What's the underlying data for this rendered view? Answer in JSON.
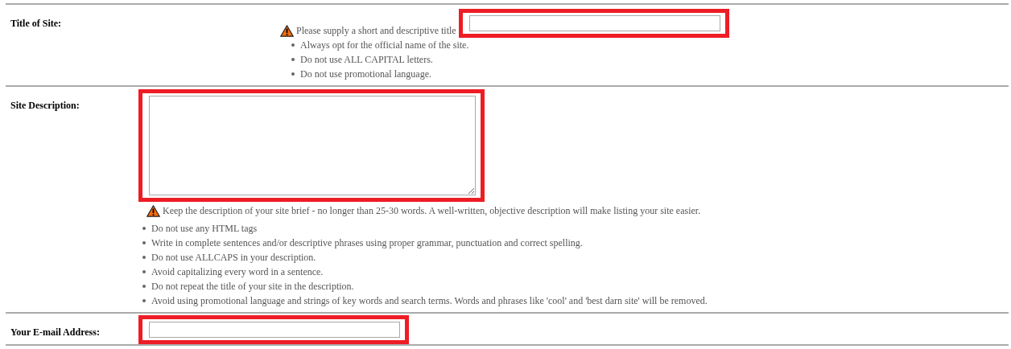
{
  "rows": [
    {
      "kind": "inline-field",
      "label": "Title of Site:",
      "field": {
        "kind": "input",
        "highlighted": true
      },
      "warning": "Please supply a short and descriptive title",
      "tips": [
        "Always opt for the official name of the site.",
        "Do not use ALL CAPITAL letters.",
        "Do not use promotional language."
      ]
    },
    {
      "kind": "field-above",
      "label": "Site Description:",
      "field": {
        "kind": "textarea",
        "highlighted": true
      },
      "warning": "Keep the description of your site brief - no longer than 25-30 words. A well-written, objective description will make listing your site easier.",
      "tips": [
        "Do not use any HTML tags",
        "Write in complete sentences and/or descriptive phrases using proper grammar, punctuation and correct spelling.",
        "Do not use ALLCAPS in your description.",
        "Avoid capitalizing every word in a sentence.",
        "Do not repeat the title of your site in the description.",
        "Avoid using promotional language and strings of key words and search terms. Words and phrases like 'cool' and 'best darn site' will be removed."
      ]
    },
    {
      "kind": "field-only",
      "label": "Your E-mail Address:",
      "field": {
        "kind": "input",
        "highlighted": true
      }
    }
  ]
}
